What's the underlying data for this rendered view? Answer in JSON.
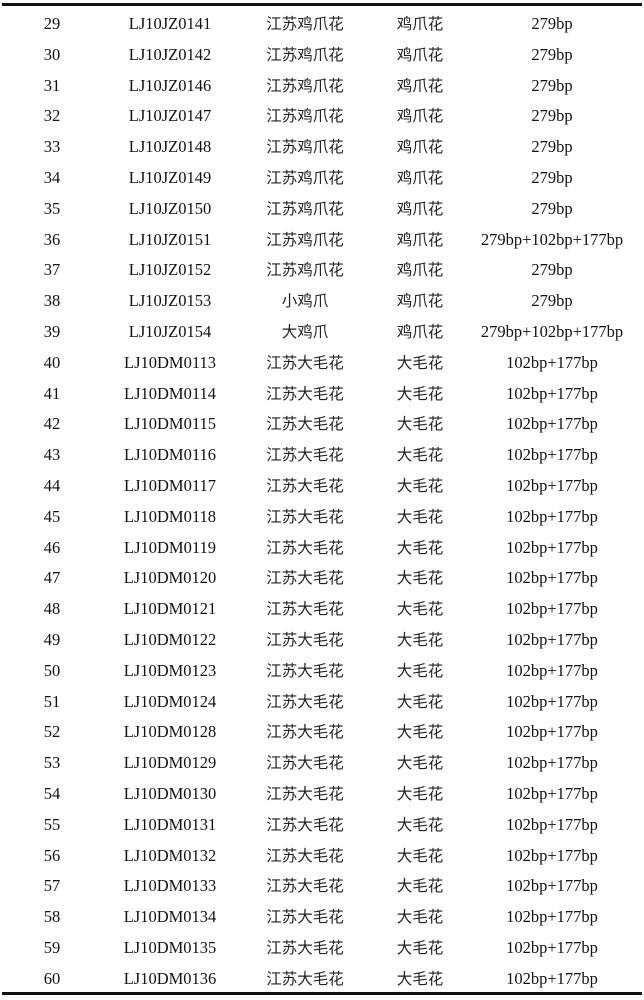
{
  "table": {
    "rows": [
      [
        "29",
        "LJ10JZ0141",
        "江苏鸡爪花",
        "鸡爪花",
        "279bp"
      ],
      [
        "30",
        "LJ10JZ0142",
        "江苏鸡爪花",
        "鸡爪花",
        "279bp"
      ],
      [
        "31",
        "LJ10JZ0146",
        "江苏鸡爪花",
        "鸡爪花",
        "279bp"
      ],
      [
        "32",
        "LJ10JZ0147",
        "江苏鸡爪花",
        "鸡爪花",
        "279bp"
      ],
      [
        "33",
        "LJ10JZ0148",
        "江苏鸡爪花",
        "鸡爪花",
        "279bp"
      ],
      [
        "34",
        "LJ10JZ0149",
        "江苏鸡爪花",
        "鸡爪花",
        "279bp"
      ],
      [
        "35",
        "LJ10JZ0150",
        "江苏鸡爪花",
        "鸡爪花",
        "279bp"
      ],
      [
        "36",
        "LJ10JZ0151",
        "江苏鸡爪花",
        "鸡爪花",
        "279bp+102bp+177bp"
      ],
      [
        "37",
        "LJ10JZ0152",
        "江苏鸡爪花",
        "鸡爪花",
        "279bp"
      ],
      [
        "38",
        "LJ10JZ0153",
        "小鸡爪",
        "鸡爪花",
        "279bp"
      ],
      [
        "39",
        "LJ10JZ0154",
        "大鸡爪",
        "鸡爪花",
        "279bp+102bp+177bp"
      ],
      [
        "40",
        "LJ10DM0113",
        "江苏大毛花",
        "大毛花",
        "102bp+177bp"
      ],
      [
        "41",
        "LJ10DM0114",
        "江苏大毛花",
        "大毛花",
        "102bp+177bp"
      ],
      [
        "42",
        "LJ10DM0115",
        "江苏大毛花",
        "大毛花",
        "102bp+177bp"
      ],
      [
        "43",
        "LJ10DM0116",
        "江苏大毛花",
        "大毛花",
        "102bp+177bp"
      ],
      [
        "44",
        "LJ10DM0117",
        "江苏大毛花",
        "大毛花",
        "102bp+177bp"
      ],
      [
        "45",
        "LJ10DM0118",
        "江苏大毛花",
        "大毛花",
        "102bp+177bp"
      ],
      [
        "46",
        "LJ10DM0119",
        "江苏大毛花",
        "大毛花",
        "102bp+177bp"
      ],
      [
        "47",
        "LJ10DM0120",
        "江苏大毛花",
        "大毛花",
        "102bp+177bp"
      ],
      [
        "48",
        "LJ10DM0121",
        "江苏大毛花",
        "大毛花",
        "102bp+177bp"
      ],
      [
        "49",
        "LJ10DM0122",
        "江苏大毛花",
        "大毛花",
        "102bp+177bp"
      ],
      [
        "50",
        "LJ10DM0123",
        "江苏大毛花",
        "大毛花",
        "102bp+177bp"
      ],
      [
        "51",
        "LJ10DM0124",
        "江苏大毛花",
        "大毛花",
        "102bp+177bp"
      ],
      [
        "52",
        "LJ10DM0128",
        "江苏大毛花",
        "大毛花",
        "102bp+177bp"
      ],
      [
        "53",
        "LJ10DM0129",
        "江苏大毛花",
        "大毛花",
        "102bp+177bp"
      ],
      [
        "54",
        "LJ10DM0130",
        "江苏大毛花",
        "大毛花",
        "102bp+177bp"
      ],
      [
        "55",
        "LJ10DM0131",
        "江苏大毛花",
        "大毛花",
        "102bp+177bp"
      ],
      [
        "56",
        "LJ10DM0132",
        "江苏大毛花",
        "大毛花",
        "102bp+177bp"
      ],
      [
        "57",
        "LJ10DM0133",
        "江苏大毛花",
        "大毛花",
        "102bp+177bp"
      ],
      [
        "58",
        "LJ10DM0134",
        "江苏大毛花",
        "大毛花",
        "102bp+177bp"
      ],
      [
        "59",
        "LJ10DM0135",
        "江苏大毛花",
        "大毛花",
        "102bp+177bp"
      ],
      [
        "60",
        "LJ10DM0136",
        "江苏大毛花",
        "大毛花",
        "102bp+177bp"
      ]
    ]
  }
}
